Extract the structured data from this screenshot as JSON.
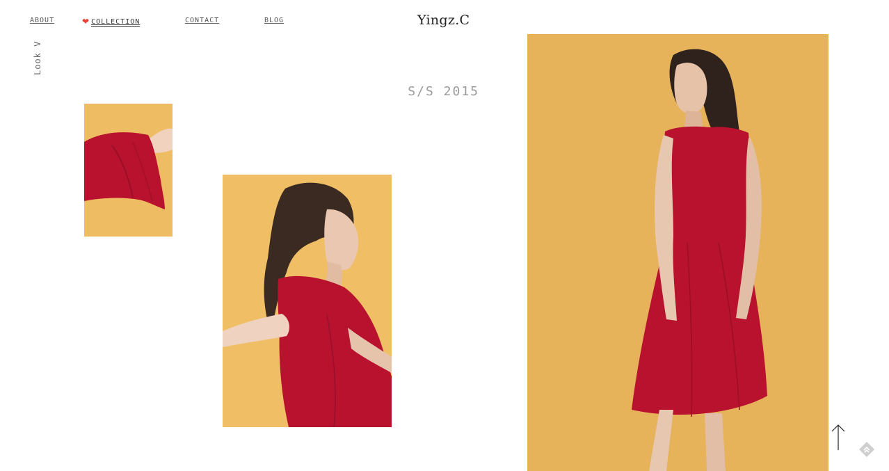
{
  "nav": {
    "about": "ABOUT",
    "collection": "COLLECTION",
    "contact": "CONTACT",
    "blog": "BLOG",
    "active_icon": "heart-icon"
  },
  "brand": {
    "logo": "Yingz.C"
  },
  "collection": {
    "look_label": "Look V",
    "season": "S/S 2015"
  },
  "photos": [
    {
      "name": "photo-sleeve-detail",
      "subject": "red bell sleeve on yellow background"
    },
    {
      "name": "photo-profile",
      "subject": "model in red sleeveless dress, side profile"
    },
    {
      "name": "photo-full-length",
      "subject": "model in red sleeveless midi dress, full length"
    }
  ],
  "controls": {
    "back_to_top_icon": "arrow-up-icon",
    "corner_icon": "feedly-icon"
  },
  "colors": {
    "accent_heart": "#e8423a",
    "photo_background": "#e9b65c",
    "dress": "#b8122e"
  }
}
